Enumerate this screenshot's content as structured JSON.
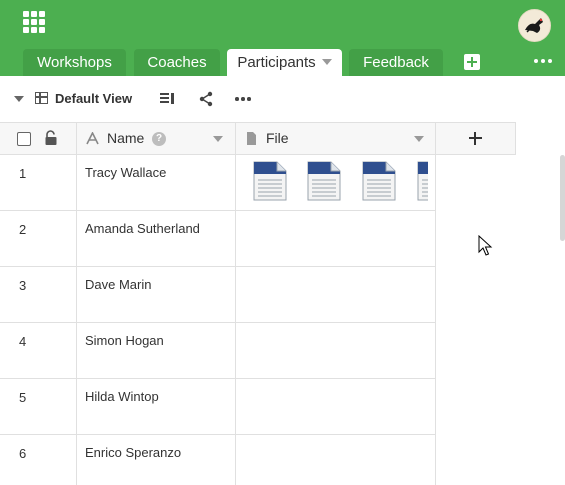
{
  "tabs": [
    {
      "label": "Workshops",
      "active": false
    },
    {
      "label": "Coaches",
      "active": false
    },
    {
      "label": "Participants",
      "active": true
    },
    {
      "label": "Feedback",
      "active": false
    }
  ],
  "toolbar": {
    "view_name": "Default View"
  },
  "columns": {
    "name": "Name",
    "file": "File"
  },
  "rows": [
    {
      "index": "1",
      "name": "Tracy Wallace",
      "files": 4
    },
    {
      "index": "2",
      "name": "Amanda Sutherland",
      "files": 0
    },
    {
      "index": "3",
      "name": "Dave Marin",
      "files": 0
    },
    {
      "index": "4",
      "name": "Simon Hogan",
      "files": 0
    },
    {
      "index": "5",
      "name": "Hilda Wintop",
      "files": 0
    },
    {
      "index": "6",
      "name": "Enrico Speranzo",
      "files": 0
    }
  ],
  "icons": [
    "app-grid-icon",
    "avatar",
    "add-table-icon",
    "more-icon",
    "table-view-icon",
    "hide-columns-icon",
    "share-icon",
    "lock-icon",
    "text-type-icon",
    "file-type-icon",
    "help-icon",
    "document-icon",
    "mouse-cursor-icon"
  ],
  "colors": {
    "brand": "#4caf50",
    "tab_inactive": "#43a047",
    "file_icon": "#2f4f8f"
  }
}
